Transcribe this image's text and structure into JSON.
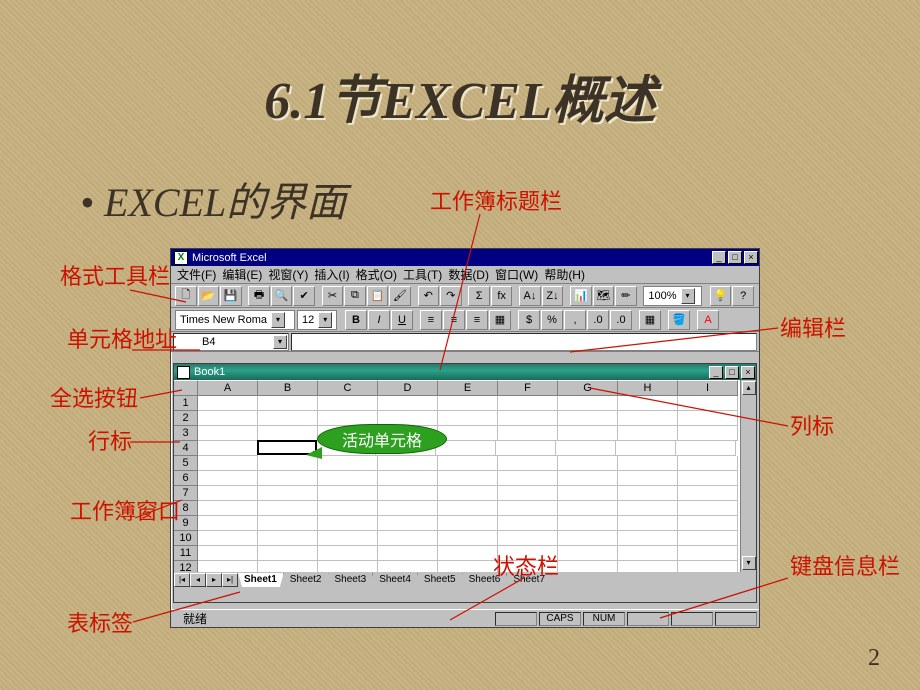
{
  "slide": {
    "title": "6.1节EXCEL概述",
    "bullet": "• EXCEL的界面",
    "page_number": "2"
  },
  "excel": {
    "app_title": "Microsoft Excel",
    "menus": [
      "文件(F)",
      "编辑(E)",
      "视窗(Y)",
      "插入(I)",
      "格式(O)",
      "工具(T)",
      "数据(D)",
      "窗口(W)",
      "帮助(H)"
    ],
    "font_name": "Times New Roma",
    "font_size": "12",
    "zoom": "100%",
    "name_box": "B4",
    "book_title": "Book1",
    "columns": [
      "A",
      "B",
      "C",
      "D",
      "E",
      "F",
      "G",
      "H",
      "I"
    ],
    "rows": [
      "1",
      "2",
      "3",
      "4",
      "5",
      "6",
      "7",
      "8",
      "9",
      "10",
      "11",
      "12"
    ],
    "tabs": [
      "Sheet1",
      "Sheet2",
      "Sheet3",
      "Sheet4",
      "Sheet5",
      "Sheet6",
      "Sheet7"
    ],
    "active_tab": "Sheet1",
    "status_ready": "就绪",
    "status_caps": "CAPS",
    "status_num": "NUM"
  },
  "annotations": {
    "titlebar": "工作簿标题栏",
    "format_toolbar": "格式工具栏",
    "cell_address": "单元格地址",
    "select_all": "全选按钮",
    "row_header": "行标",
    "workbook_window": "工作簿窗口",
    "sheet_tab": "表标签",
    "edit_bar": "编辑栏",
    "column_header": "列标",
    "keyboard_info": "键盘信息栏",
    "status_bar": "状态栏",
    "active_cell": "活动单元格"
  }
}
